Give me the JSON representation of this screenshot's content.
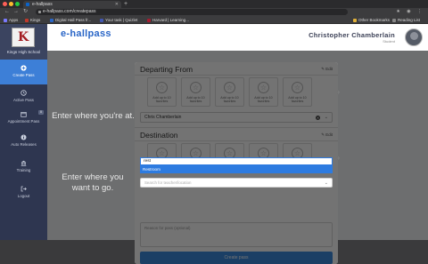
{
  "browser": {
    "tab_title": "e-hallpass",
    "url": "e-hallpass.com/createpass",
    "bookmarks": [
      {
        "label": "Apps",
        "color": "#7a7aff"
      },
      {
        "label": "Kings",
        "color": "#c0392b"
      },
      {
        "label": "Digital Hall Pass fr...",
        "color": "#2a66c7"
      },
      {
        "label": "Your task | Quizlet",
        "color": "#4257b2"
      },
      {
        "label": "Harvard | Learning...",
        "color": "#a51c30"
      },
      {
        "label": "Other Bookmarks",
        "color": "#e0b03a"
      },
      {
        "label": "Reading List",
        "color": "#888888"
      }
    ]
  },
  "sidebar": {
    "school_name": "Kings High School",
    "items": [
      {
        "label": "Create Pass",
        "icon": "plus-circle-icon",
        "active": true
      },
      {
        "label": "Active Pass",
        "icon": "clock-icon"
      },
      {
        "label": "Appointment Pass",
        "icon": "calendar-icon",
        "badge": "0"
      },
      {
        "label": "Auto Releases",
        "icon": "info-icon"
      },
      {
        "label": "Training",
        "icon": "building-icon"
      },
      {
        "label": "Logout",
        "icon": "logout-icon"
      }
    ]
  },
  "header": {
    "brand": "e-hallpass",
    "user_name": "Christopher Chamberlain",
    "user_role": "Student"
  },
  "prompts": {
    "where_at": "Enter where you're at.",
    "where_go": "Enter where you want to go."
  },
  "departing": {
    "title": "Departing From",
    "edit_label": "Edit",
    "favorite_label": "Add up to 10 favorites",
    "selected": "Chris Chamberlain"
  },
  "destination": {
    "title": "Destination",
    "edit_label": "Edit",
    "favorite_label": "Add up to 10 favorites",
    "search_value": "rest",
    "highlighted_option": "Restroom",
    "select_placeholder": "Search for teacher/location"
  },
  "reason": {
    "placeholder": "Reason for pass (optional)"
  },
  "create_button": "Create pass"
}
